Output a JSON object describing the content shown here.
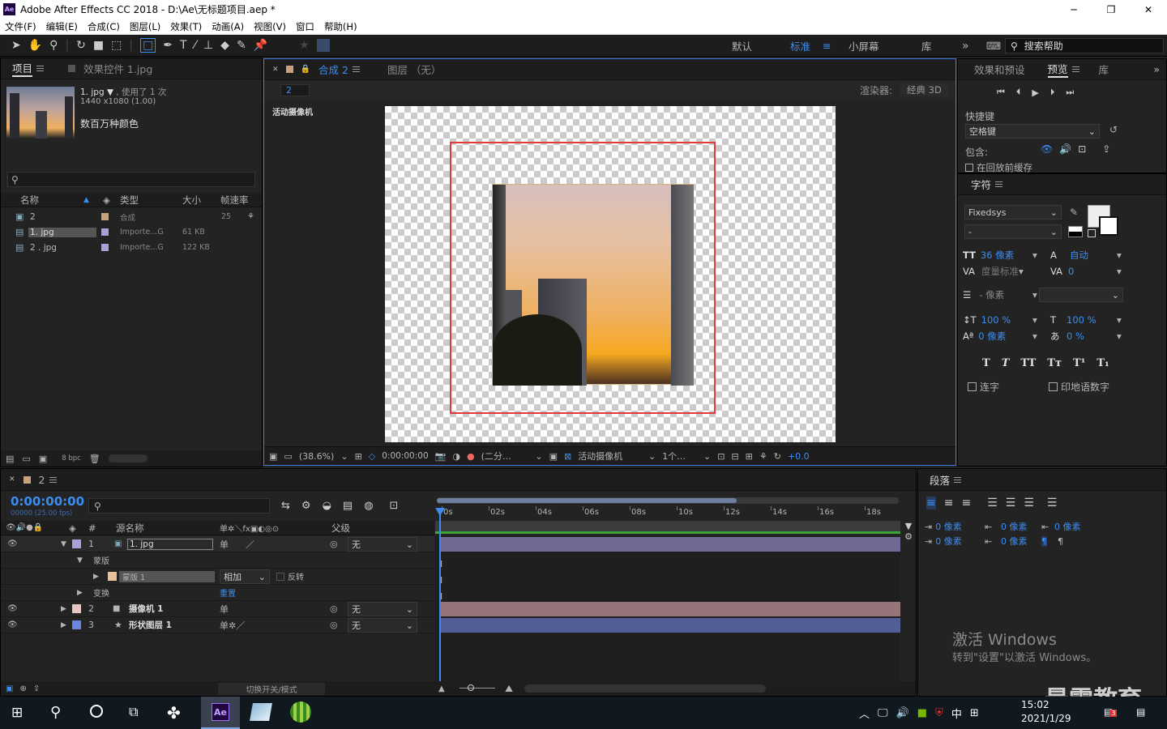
{
  "app": {
    "title": "Adobe After Effects CC 2018 - D:\\Ae\\无标题项目.aep *",
    "icon_text": "Ae"
  },
  "menu": [
    "文件(F)",
    "编辑(E)",
    "合成(C)",
    "图层(L)",
    "效果(T)",
    "动画(A)",
    "视图(V)",
    "窗口",
    "帮助(H)"
  ],
  "workspaces": {
    "default": "默认",
    "standard": "标准",
    "small": "小屏幕",
    "library": "库",
    "search": "搜索帮助"
  },
  "project": {
    "tab": "项目",
    "effects_tab": "效果控件 1.jpg",
    "item_name": "1. jpg ▼",
    "item_used": ", 使用了 1 次",
    "item_dims": "1440 x1080 (1.00)",
    "item_color": "数百万种颜色",
    "headers": {
      "name": "名称",
      "type": "类型",
      "size": "大小",
      "fps": "帧速率"
    },
    "rows": [
      {
        "name": "2",
        "type": "合成",
        "size": "",
        "fps": "25",
        "color": "#c8a27a"
      },
      {
        "name": "1. jpg",
        "type": "Importe...G",
        "size": "61 KB",
        "fps": "",
        "color": "#a9a2d8"
      },
      {
        "name": "2 . jpg",
        "type": "Importe...G",
        "size": "122 KB",
        "fps": "",
        "color": "#a9a2d8"
      }
    ],
    "bpc": "8 bpc"
  },
  "comp": {
    "tab": "合成 2",
    "layer_tab": "图层 （无）",
    "subtab": "2",
    "renderer_label": "渲染器:",
    "renderer": "经典 3D",
    "camera_label": "活动摄像机",
    "footer": {
      "zoom": "(38.6%)",
      "time": "0:00:00:00",
      "res": "(二分…",
      "camera": "活动摄像机",
      "views": "1个…",
      "exposure": "+0.0"
    }
  },
  "preview": {
    "tab_effects": "效果和预设",
    "tab_preview": "预览",
    "tab_lib": "库",
    "shortcut_label": "快捷键",
    "shortcut": "空格键",
    "include": "包含:",
    "cache": "在回放前缓存"
  },
  "character": {
    "tab": "字符",
    "font": "Fixedsys",
    "style": "-",
    "size": "36 像素",
    "leading": "自动",
    "kerning": "度量标准",
    "tracking": "0",
    "stroke": "- 像素",
    "vscale": "100 %",
    "hscale": "100 %",
    "baseline": "0 像素",
    "tsume": "0 %",
    "ligature": "连字",
    "hindi": "印地语数字",
    "styles": [
      "T",
      "T",
      "TT",
      "Tт",
      "T¹",
      "T₁"
    ]
  },
  "paragraph": {
    "tab": "段落",
    "indent": [
      "0 像素",
      "0 像素",
      "0 像素",
      "0 像素",
      "0 像素"
    ]
  },
  "timeline": {
    "tab": "2",
    "timecode": "0:00:00:00",
    "frame_info": "00000 (25.00 fps)",
    "headers": {
      "num": "#",
      "source": "源名称",
      "parent": "父级"
    },
    "ruler": [
      "0s",
      "02s",
      "04s",
      "06s",
      "08s",
      "10s",
      "12s",
      "14s",
      "16s",
      "18s"
    ],
    "layers": [
      {
        "num": "1",
        "name": "1. jpg",
        "parent": "无",
        "color": "#a9a2d8"
      },
      {
        "num": "2",
        "name": "摄像机 1",
        "parent": "无",
        "color": "#e8c7c3"
      },
      {
        "num": "3",
        "name": "形状图层 1",
        "parent": "无",
        "color": "#6b86e0"
      }
    ],
    "mask_group": "蒙版",
    "mask": "蒙版 1",
    "mask_mode": "相加",
    "invert": "反转",
    "transform": "变换",
    "reset": "重置",
    "toggle": "切换开关/模式"
  },
  "watermark": {
    "title": "激活 Windows",
    "sub": "转到\"设置\"以激活 Windows。",
    "brand": "最需教育"
  },
  "taskbar": {
    "time": "15:02",
    "date": "2021/1/29",
    "ime": "中"
  }
}
